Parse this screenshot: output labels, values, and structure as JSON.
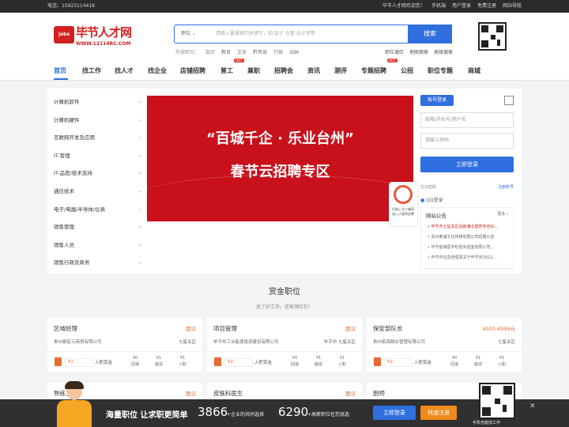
{
  "topbar": {
    "phone": "电话：15923114419",
    "welcome": "毕节人才网欢迎您！",
    "mobile": "手机端",
    "user_login": "用户登录",
    "free_reg": "免费注册",
    "site_nav": "网站导航"
  },
  "logo": {
    "mark": "jobs",
    "name": "毕节人才网",
    "url": "WWW.12114RC.COM"
  },
  "search": {
    "category": "职位",
    "placeholder": "请输入要搜索的关键字，如 会计 仓管 设计师等",
    "button": "搜索",
    "hot_label": "热搜职位：",
    "hot": [
      "会计",
      "教育",
      "文员",
      "黔西县",
      "行政",
      "出纳"
    ],
    "links": [
      "职位速匹",
      "地图搜索",
      "高级搜索"
    ]
  },
  "nav": {
    "items": [
      "首页",
      "找工作",
      "找人才",
      "找企业",
      "店铺招聘",
      "普工",
      "兼职",
      "招聘会",
      "资讯",
      "测评",
      "专题招聘",
      "公招",
      "职位专题",
      "商城"
    ],
    "hot_badge": "HOT"
  },
  "categories": [
    "计算机软件",
    "计算机硬件",
    "互联网开发及应用",
    "IT-管理",
    "IT-品管/技术支持",
    "通信技术",
    "电子/电器/半导体/仪表",
    "销售管理",
    "销售人员",
    "销售行政及商务"
  ],
  "category_arrow": "›",
  "banner": {
    "line1": "“百城千企 · 乐业台州”",
    "line2": "春节云招聘专区",
    "badge_text": "扫描上方二维码 进入小程序应聘"
  },
  "login": {
    "tab": "账号登录",
    "user_placeholder": "邮箱/手机号/用户名",
    "pass_placeholder": "请输入密码",
    "submit": "立即登录",
    "forgot": "忘记密码",
    "register": "注册账号",
    "qq": "QQ登录"
  },
  "notice": {
    "title": "网站公告",
    "more": "更多 ›",
    "items": [
      "毕节市七星关区远航满北建筑专培训...",
      "贵州黄浦文化传媒有限公司招聘公告",
      "毕节金域医学检验实验室有限公司...",
      "毕节市应急管理局关于毕节市2022..."
    ]
  },
  "section": {
    "title": "赏金职位",
    "subtitle": "找了好工作，还能领红包！"
  },
  "jobs": [
    {
      "title": "区域经理",
      "salary": "面议",
      "company": "贵州御臣元商贸有限公司",
      "loc": "七星关区",
      "amount": "¥2",
      "reward": "入职赏金",
      "s1": "¥0",
      "s1l": "回递",
      "s2": "¥1",
      "s2l": "面试",
      "s3": "¥1",
      "s3l": "入职"
    },
    {
      "title": "项目管理",
      "salary": "面议",
      "company": "毕节市工业能源投资建设有限公司",
      "loc": "毕节市 七星关区",
      "amount": "¥2",
      "reward": "入职赏金",
      "s1": "¥0",
      "s1l": "回递",
      "s2": "¥1",
      "s2l": "面试",
      "s3": "¥1",
      "s3l": "入职"
    },
    {
      "title": "保安部队长",
      "salary": "4000-4999元",
      "company": "贵州拓海物业管理有限公司",
      "loc": "七星关区",
      "amount": "¥2",
      "reward": "入职赏金",
      "s1": "¥0",
      "s1l": "回递",
      "s2": "¥1",
      "s2l": "面试",
      "s3": "¥1",
      "s3l": "入职"
    },
    {
      "title": "熟练工",
      "salary": "面议"
    },
    {
      "title": "皮肤科医生",
      "salary": "面议"
    },
    {
      "title": "厨师",
      "salary": "面议"
    }
  ],
  "footbar": {
    "headline": "海量职位 让求职更简单",
    "n1": "3866",
    "t1": "+企业的共同选择",
    "n2": "6290",
    "t2": "+高薪职位任您挑选",
    "login": "立即登录",
    "register": "快速注册",
    "close": "✕",
    "qr_text": "手机也能找工作"
  },
  "colors": {
    "accent": "#2f6fdf",
    "brand_red": "#d32020",
    "orange": "#e66b2f"
  }
}
